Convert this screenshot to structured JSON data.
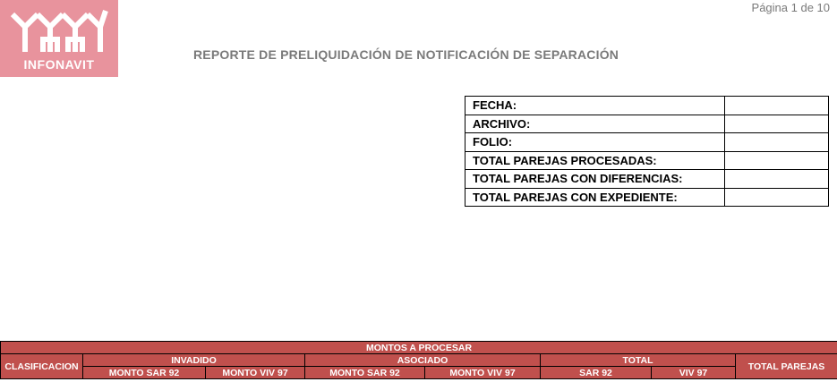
{
  "logo": {
    "text": "INFONAVIT",
    "color": "#e8939d"
  },
  "page_number": "Página 1 de 10",
  "report_title": "REPORTE DE PRELIQUIDACIÓN DE NOTIFICACIÓN DE SEPARACIÓN",
  "info_rows": [
    {
      "label": "FECHA:",
      "value": ""
    },
    {
      "label": "ARCHIVO:",
      "value": ""
    },
    {
      "label": "FOLIO:",
      "value": ""
    },
    {
      "label": "TOTAL PAREJAS PROCESADAS:",
      "value": ""
    },
    {
      "label": "TOTAL PAREJAS CON DIFERENCIAS:",
      "value": ""
    },
    {
      "label": "TOTAL PAREJAS CON EXPEDIENTE:",
      "value": ""
    }
  ],
  "amounts_table": {
    "header_color": "#c0504d",
    "title": "MONTOS A PROCESAR",
    "clasificacion": "CLASIFICACION",
    "total_parejas": "TOTAL PAREJAS",
    "groups": [
      {
        "label": "INVADIDO",
        "columns": [
          "MONTO SAR 92",
          "MONTO VIV 97"
        ]
      },
      {
        "label": "ASOCIADO",
        "columns": [
          "MONTO SAR 92",
          "MONTO VIV 97"
        ]
      },
      {
        "label": "TOTAL",
        "columns": [
          "SAR 92",
          "VIV 97"
        ]
      }
    ]
  }
}
